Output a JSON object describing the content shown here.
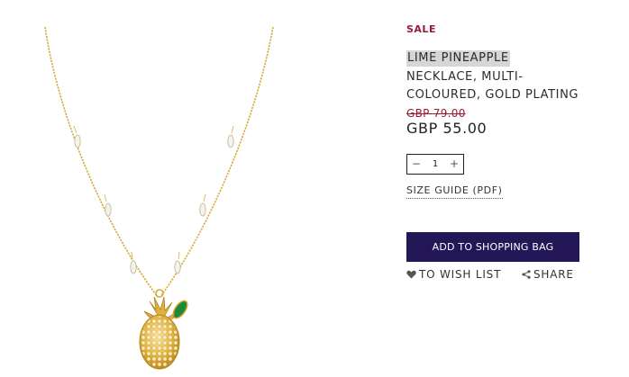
{
  "product": {
    "sale_label": "SALE",
    "name_line1": "LIME PINEAPPLE",
    "name_line2": "NECKLACE, MULTI-",
    "name_line3": "COLOURED, GOLD PLATING",
    "old_price": "GBP 79.00",
    "price": "GBP 55.00"
  },
  "quantity": {
    "minus": "−",
    "value": "1",
    "plus": "+"
  },
  "size_guide_label": "SIZE GUIDE (PDF)",
  "add_to_bag_label": "ADD TO SHOPPING BAG",
  "wish_list_label": "TO WISH LIST",
  "share_label": "SHARE",
  "icons": {
    "wish": "heart-icon",
    "share": "share-icon"
  },
  "colors": {
    "sale": "#9a1b38",
    "button": "#231757",
    "gold": "#d4a62a",
    "emerald": "#1a8a3c"
  }
}
